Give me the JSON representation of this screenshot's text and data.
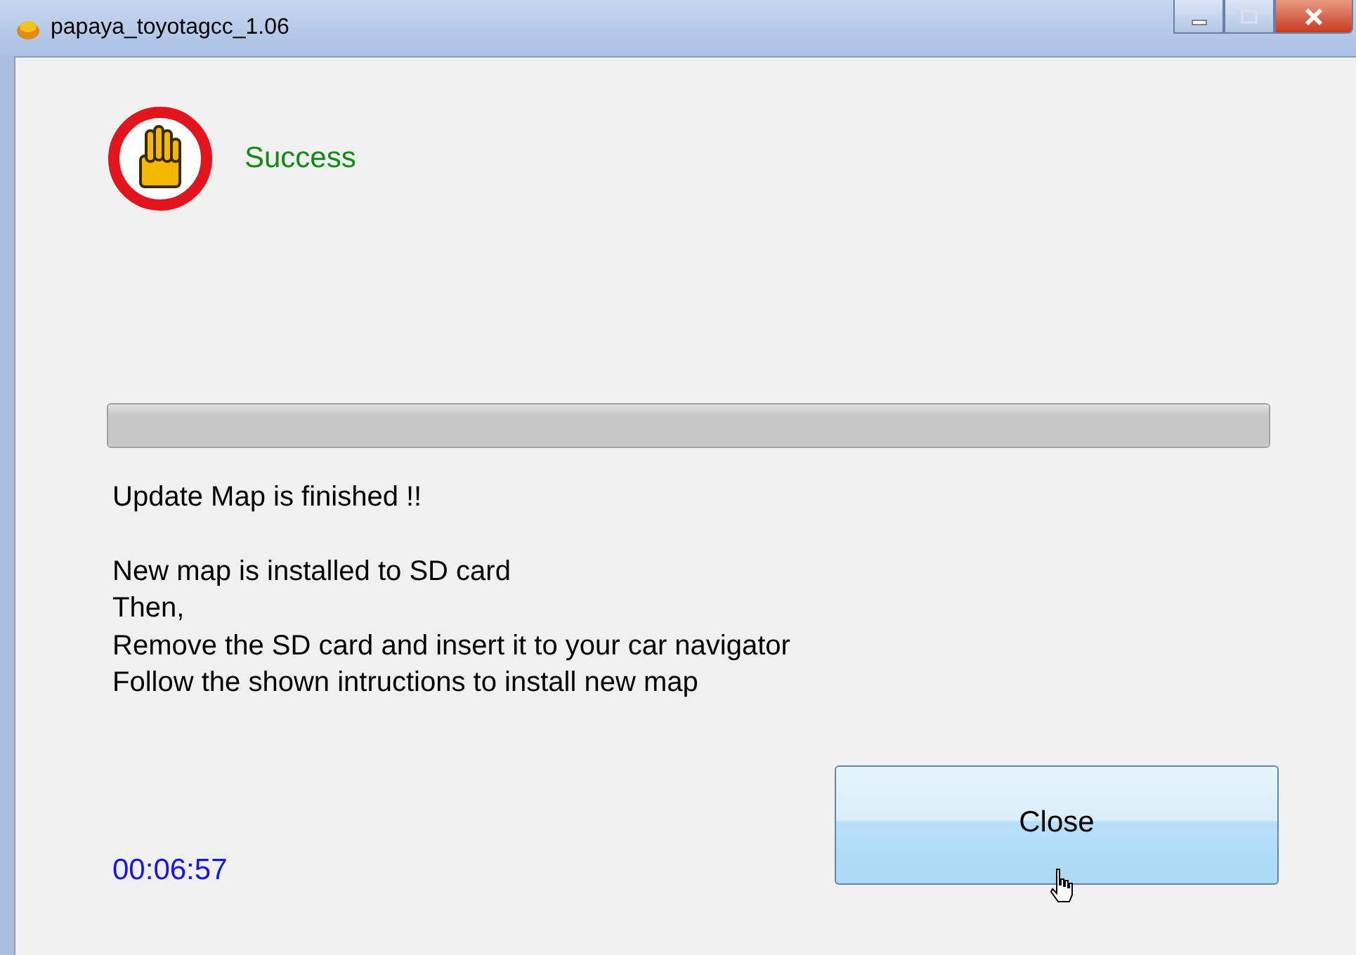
{
  "window": {
    "title": "papaya_toyotagcc_1.06"
  },
  "status": {
    "text": "Success"
  },
  "progress": {
    "level": 1
  },
  "message": {
    "headline": "Update Map is finished !!",
    "lines": [
      "New map is installed to SD card",
      "Then,",
      "Remove the SD card and insert it to your car navigator",
      "Follow the shown intructions to install new map"
    ]
  },
  "timer": "00:06:57",
  "close_button": "Close"
}
